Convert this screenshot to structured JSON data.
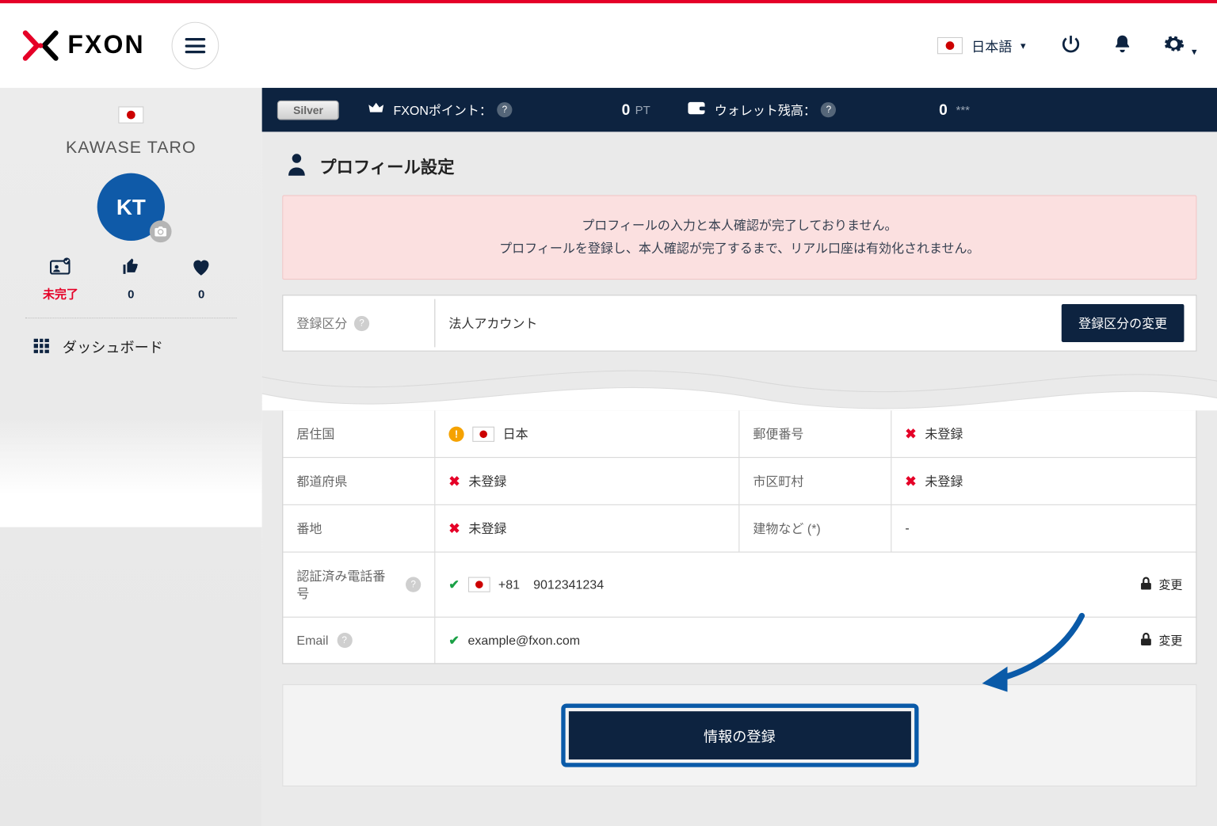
{
  "header": {
    "logo_text": "FXON",
    "language_label": "日本語"
  },
  "sidebar": {
    "user_name": "KAWASE TARO",
    "avatar_initials": "KT",
    "stats": {
      "incomplete_label": "未完了",
      "likes": "0",
      "favorites": "0"
    },
    "nav": {
      "dashboard": "ダッシュボード"
    }
  },
  "strip": {
    "tier_badge": "Silver",
    "points_label": "FXONポイント：",
    "points_value": "0",
    "points_unit": "PT",
    "wallet_label": "ウォレット残高：",
    "wallet_value": "0",
    "wallet_masked": "***"
  },
  "page": {
    "title": "プロフィール設定",
    "alert_line1": "プロフィールの入力と本人確認が完了しておりません。",
    "alert_line2": "プロフィールを登録し、本人確認が完了するまで、リアル口座は有効化されません。",
    "reg": {
      "label": "登録区分",
      "value": "法人アカウント",
      "change_btn": "登録区分の変更"
    },
    "table": {
      "country_label": "居住国",
      "country_value": "日本",
      "postal_label": "郵便番号",
      "unregistered": "未登録",
      "prefecture_label": "都道府県",
      "city_label": "市区町村",
      "address_label": "番地",
      "building_label": "建物など (*)",
      "building_value": "-",
      "phone_label": "認証済み電話番号",
      "phone_code": "+81",
      "phone_number": "9012341234",
      "email_label": "Email",
      "email_value": "example@fxon.com",
      "change_label": "変更"
    },
    "submit_btn": "情報の登録"
  }
}
